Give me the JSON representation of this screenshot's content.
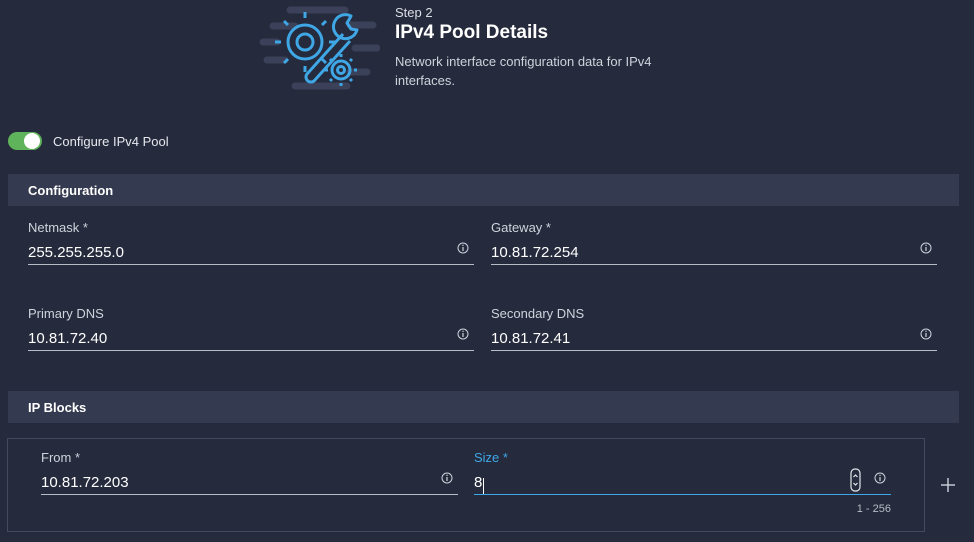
{
  "header": {
    "step": "Step 2",
    "title": "IPv4 Pool Details",
    "description": "Network interface configuration data for IPv4 interfaces."
  },
  "toggle": {
    "label": "Configure IPv4 Pool",
    "on": true
  },
  "sections": {
    "configuration": "Configuration",
    "ip_blocks": "IP Blocks"
  },
  "fields": {
    "netmask": {
      "label": "Netmask *",
      "value": "255.255.255.0"
    },
    "gateway": {
      "label": "Gateway *",
      "value": "10.81.72.254"
    },
    "primary_dns": {
      "label": "Primary DNS",
      "value": "10.81.72.40"
    },
    "secondary_dns": {
      "label": "Secondary DNS",
      "value": "10.81.72.41"
    }
  },
  "ip_block": {
    "from": {
      "label": "From *",
      "value": "10.81.72.203"
    },
    "size": {
      "label": "Size *",
      "value": "8",
      "hint": "1 - 256"
    }
  },
  "colors": {
    "background": "#252a3c",
    "section_bar": "#343a4f",
    "toggle_on": "#5fb35a",
    "accent": "#3fa7e6"
  },
  "icons": {
    "hero": "settings-wrench-icon",
    "info": "info-icon",
    "stepper": "stepper-icon",
    "add": "plus-icon"
  }
}
